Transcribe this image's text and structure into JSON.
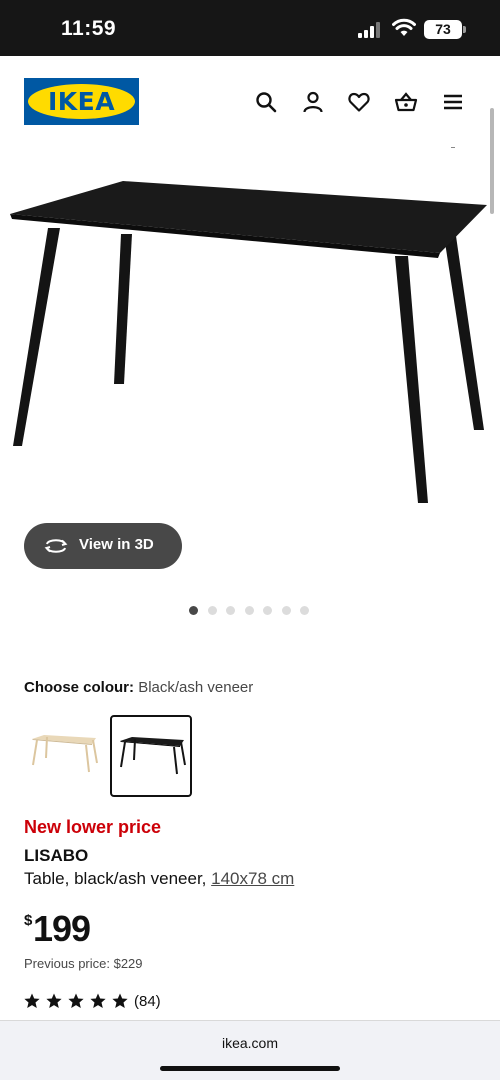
{
  "status": {
    "time": "11:59",
    "battery": "73"
  },
  "header": {
    "logo_text": "IKEA",
    "icons": [
      "search-icon",
      "user-icon",
      "heart-icon",
      "basket-icon",
      "menu-icon"
    ]
  },
  "gallery": {
    "view3d_label": "View in 3D",
    "dot_count": 7,
    "active_dot": 1
  },
  "colour": {
    "label": "Choose colour:",
    "value": "Black/ash veneer",
    "options": [
      "white-stained ash veneer",
      "black/ash veneer"
    ],
    "selected": 2
  },
  "product": {
    "promo": "New lower price",
    "name": "LISABO",
    "description": "Table, black/ash veneer,",
    "size": "140x78 cm",
    "currency": "$",
    "price": "199",
    "previous_price": "Previous price: $229",
    "rating_stars": 5,
    "review_count": "(84)"
  },
  "browser": {
    "url": "ikea.com"
  },
  "colors": {
    "ikea_blue": "#0058a3",
    "ikea_yellow": "#ffdb00",
    "promo_red": "#cc0008",
    "table_black": "#141414",
    "table_ash": "#e9d8b8"
  }
}
